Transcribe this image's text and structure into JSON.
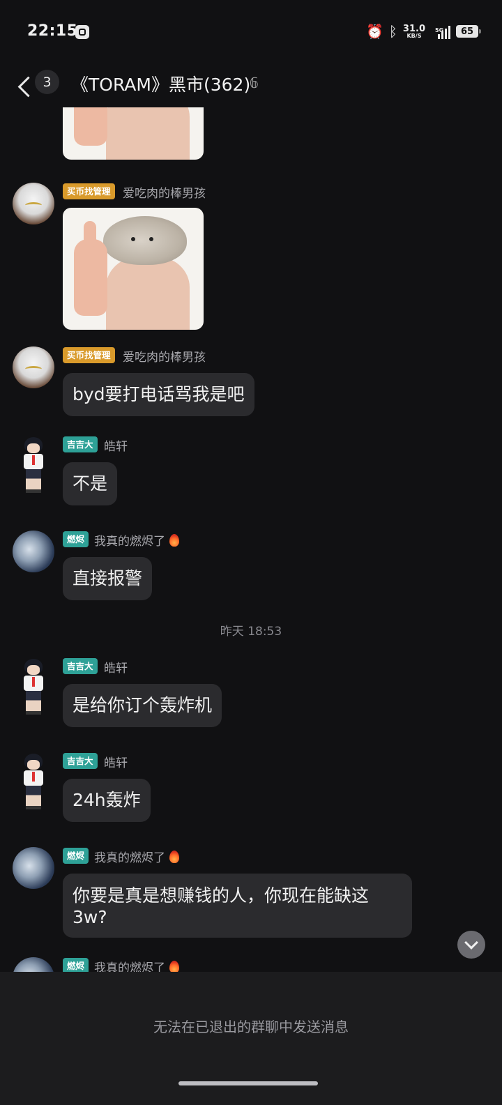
{
  "status_bar": {
    "time": "22:15",
    "net_speed": "31.0",
    "net_unit": "KB/S",
    "network_type": "5G",
    "battery": "65",
    "icons": [
      "app-icon",
      "alarm-icon",
      "bluetooth-icon",
      "signal-icon",
      "battery-icon"
    ]
  },
  "header": {
    "unread_count": "3",
    "title": "《TORAM》黑市(362)",
    "icons": [
      "back-icon",
      "ear-icon"
    ]
  },
  "messages": [
    {
      "type": "image",
      "content": "rat-thumbs-up sticker (partial)"
    },
    {
      "tag": "买币找管理",
      "name": "爱吃肉的棒男孩",
      "type": "image",
      "content": "rat-thumbs-up sticker"
    },
    {
      "tag": "买币找管理",
      "name": "爱吃肉的棒男孩",
      "type": "text",
      "text": "byd要打电话骂我是吧"
    },
    {
      "tag": "吉吉大",
      "name": "皓轩",
      "type": "text",
      "text": "不是"
    },
    {
      "tag": "燃烬",
      "name": "我真的燃烬了",
      "type": "text",
      "text": "直接报警"
    },
    {
      "type": "timestamp",
      "text": "昨天 18:53"
    },
    {
      "tag": "吉吉大",
      "name": "皓轩",
      "type": "text",
      "text": "是给你订个轰炸机"
    },
    {
      "tag": "吉吉大",
      "name": "皓轩",
      "type": "text",
      "text": "24h轰炸"
    },
    {
      "tag": "燃烬",
      "name": "我真的燃烬了",
      "type": "text",
      "text": "你要是真是想赚钱的人，你现在能缺这3w?"
    },
    {
      "tag": "燃烬",
      "name": "我真的燃烬了",
      "type": "partial"
    }
  ],
  "footer": {
    "notice": "无法在已退出的群聊中发送消息"
  },
  "colors": {
    "background": "#111113",
    "bubble": "#2b2b2e",
    "tag_gold": "#d99a2b",
    "tag_teal": "#2ea197"
  }
}
